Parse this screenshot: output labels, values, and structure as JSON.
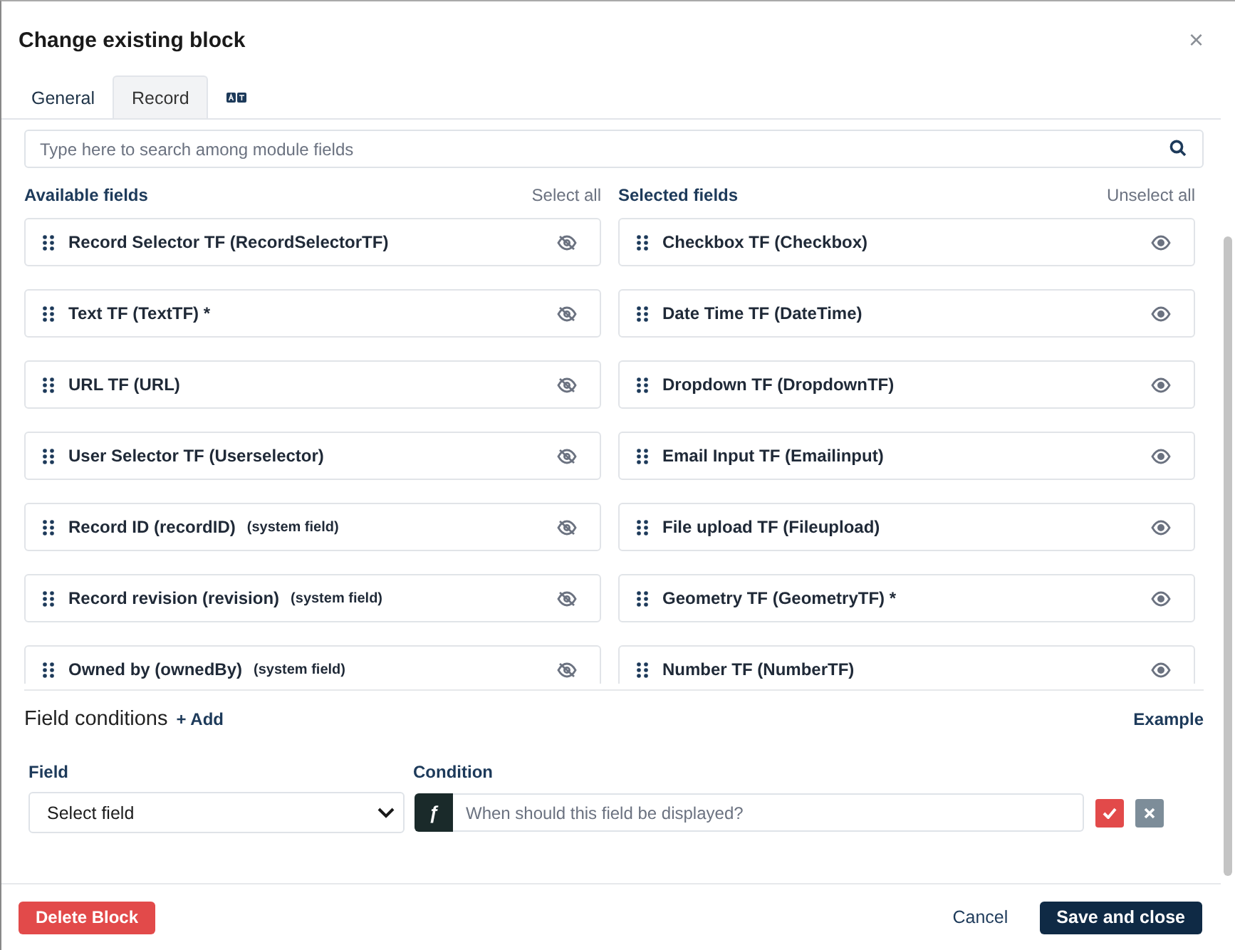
{
  "dialog": {
    "title": "Change existing block",
    "close": "×"
  },
  "tabs": [
    {
      "label": "General",
      "selected": false
    },
    {
      "label": "Record",
      "selected": true
    },
    {
      "kind": "icon",
      "selected": false
    }
  ],
  "search": {
    "placeholder": "Type here to search among module fields"
  },
  "available": {
    "title": "Available fields",
    "action": "Select all",
    "items": [
      {
        "name": "Record Selector TF (RecordSelectorTF)",
        "visible": false
      },
      {
        "name": "Text TF (TextTF) *",
        "visible": false
      },
      {
        "name": "URL TF (URL)",
        "visible": false
      },
      {
        "name": "User Selector TF (Userselector)",
        "visible": false
      },
      {
        "name": "Record ID (recordID)",
        "note": "(system field)",
        "visible": false
      },
      {
        "name": "Record revision (revision)",
        "note": "(system field)",
        "visible": false
      },
      {
        "name": "Owned by (ownedBy)",
        "note": "(system field)",
        "visible": false
      }
    ]
  },
  "selected": {
    "title": "Selected fields",
    "action": "Unselect all",
    "items": [
      {
        "name": "Checkbox TF (Checkbox)",
        "visible": true
      },
      {
        "name": "Date Time TF (DateTime)",
        "visible": true
      },
      {
        "name": "Dropdown TF (DropdownTF)",
        "visible": true
      },
      {
        "name": "Email Input TF (Emailinput)",
        "visible": true
      },
      {
        "name": "File upload TF (Fileupload)",
        "visible": true
      },
      {
        "name": "Geometry TF (GeometryTF) *",
        "visible": true
      },
      {
        "name": "Number TF (NumberTF)",
        "visible": true
      }
    ]
  },
  "conditions": {
    "title": "Field conditions",
    "add": "+ Add",
    "example": "Example",
    "field_label": "Field",
    "condition_label": "Condition",
    "rows": [
      {
        "field": "Select field",
        "prefix": "ƒ",
        "placeholder": "When should this field be displayed?"
      }
    ]
  },
  "footer": {
    "delete": "Delete Block",
    "cancel": "Cancel",
    "save": "Save and close"
  }
}
